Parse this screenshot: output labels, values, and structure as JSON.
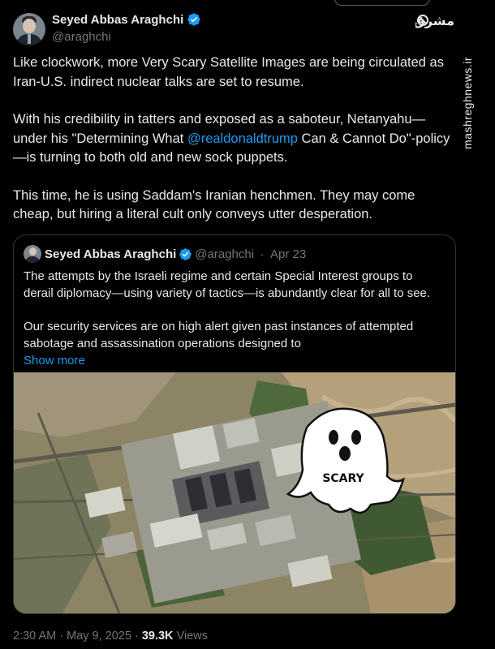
{
  "tweet": {
    "author_name": "Seyed Abbas Araghchi",
    "handle": "@araghchi",
    "text_p1": "Like clockwork, more Very Scary Satellite Images are being circulated as Iran-U.S. indirect nuclear talks are set to resume.",
    "text_p2_before": "With his credibility in tatters and exposed as a saboteur, Netanyahu—under his \"Determining What ",
    "text_p2_mention": "@realdonaldtrump",
    "text_p2_after": " Can & Cannot Do\"-policy—is turning to both old and new sock puppets.",
    "text_p3": "This time, he is using Saddam's Iranian henchmen. They may come cheap, but hiring a literal cult only conveys utter desperation.",
    "time": "2:30 AM",
    "sep": "·",
    "date": "May 9, 2025",
    "views_count": "39.3K",
    "views_label": "Views"
  },
  "quoted": {
    "author_name": "Seyed Abbas Araghchi",
    "handle": "@araghchi",
    "sep": "·",
    "date": "Apr 23",
    "text_p1": "The attempts by the Israeli regime and certain Special Interest groups to derail diplomacy—using variety of tactics—is abundantly clear for all to see.",
    "text_p2": "Our security services are on high alert given past instances of attempted sabotage and assassination operations designed to",
    "show_more": "Show more",
    "image_label": "SCARY"
  },
  "watermark": "mashreghnews.ir",
  "brand_logo_text": "مشرق",
  "colors": {
    "bg": "#000000",
    "text": "#e7e9ea",
    "muted": "#71767b",
    "link": "#1d9bf0",
    "border": "#2f3336"
  },
  "icons": [
    "verified-badge-icon",
    "brand-logo"
  ]
}
